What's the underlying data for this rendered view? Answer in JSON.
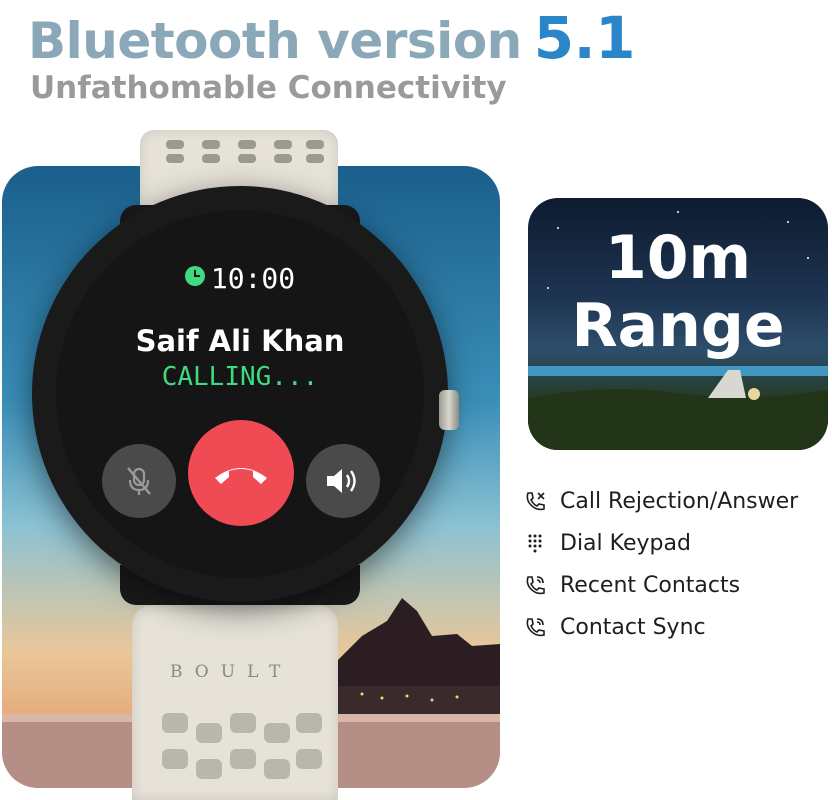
{
  "header": {
    "title_prefix": "Bluetooth version",
    "title_version": "5.1",
    "subtitle": "Unfathomable Connectivity"
  },
  "watch": {
    "brand": "BOULT",
    "screen": {
      "time": "10:00",
      "caller_name": "Saif Ali Khan",
      "status": "CALLING..."
    },
    "icons": [
      "clock-icon",
      "mic-muted-icon",
      "end-call-icon",
      "speaker-icon"
    ]
  },
  "range_card": {
    "line1": "10m",
    "line2": "Range"
  },
  "features": [
    {
      "icon": "call-reject-answer-icon",
      "label": "Call Rejection/Answer"
    },
    {
      "icon": "dial-keypad-icon",
      "label": "Dial Keypad"
    },
    {
      "icon": "recent-contacts-icon",
      "label": "Recent Contacts"
    },
    {
      "icon": "contact-sync-icon",
      "label": "Contact Sync"
    }
  ],
  "colors": {
    "title_accent": "#8aa8b8",
    "version_blue": "#2a86c8",
    "calling_green": "#3fd97f",
    "end_call_red": "#f04a55"
  }
}
